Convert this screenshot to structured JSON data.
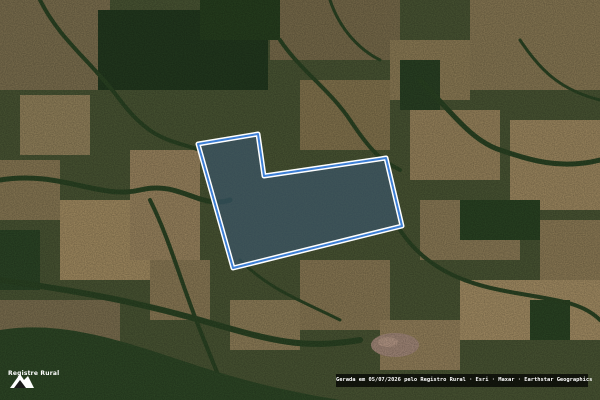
{
  "map": {
    "imagery": "satellite",
    "colors": {
      "base": "#3f4a2c",
      "field_light": "#8a7a55",
      "field_tan": "#a48d62",
      "forest_dark": "#233a1f",
      "forest_mid": "#2f4a26",
      "parcel_fill": "#3a5a7a",
      "parcel_border": "#ffffff",
      "parcel_outline": "#3d7fd6",
      "urban": "#a58a7a"
    },
    "parcel": {
      "shape": "L-shaped polygon",
      "style": "highlighted property boundary"
    }
  },
  "branding": {
    "logo_icon": "registro-rural-logo",
    "logo_text": "Registre Rural"
  },
  "attribution": {
    "text": "Gerada em 05/07/2026 pelo Registro Rural · Esri · Maxar · Earthstar Geographics"
  }
}
